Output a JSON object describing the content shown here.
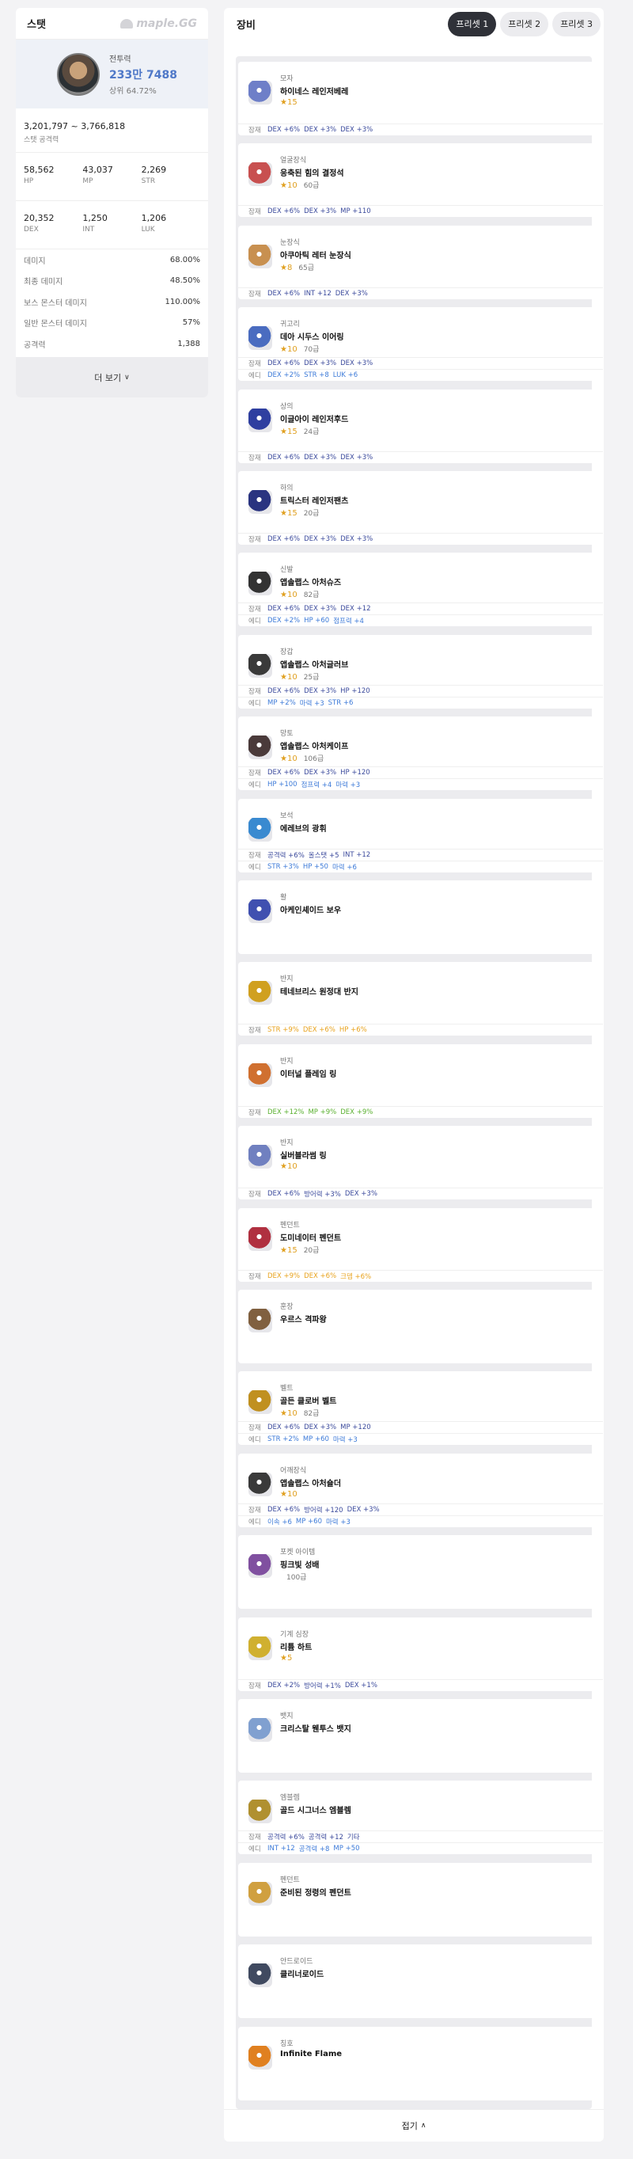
{
  "stat": {
    "title": "스탯",
    "logo": "maple.GG",
    "job": "전투력",
    "power": "233만 7488",
    "rank": "상위 64.72%",
    "range": "3,201,797 ~ 3,766,818",
    "range_label": "스탯 공격력",
    "grid1": [
      {
        "v": "58,562",
        "l": "HP"
      },
      {
        "v": "43,037",
        "l": "MP"
      },
      {
        "v": "2,269",
        "l": "STR"
      }
    ],
    "grid2": [
      {
        "v": "20,352",
        "l": "DEX"
      },
      {
        "v": "1,250",
        "l": "INT"
      },
      {
        "v": "1,206",
        "l": "LUK"
      }
    ],
    "rows": [
      {
        "l": "데미지",
        "v": "68.00%"
      },
      {
        "l": "최종 데미지",
        "v": "48.50%"
      },
      {
        "l": "보스 몬스터 데미지",
        "v": "110.00%"
      },
      {
        "l": "일반 몬스터 데미지",
        "v": "57%"
      },
      {
        "l": "공격력",
        "v": "1,388"
      }
    ],
    "more": "더 보기"
  },
  "equip": {
    "title": "장비",
    "presets": [
      "프리셋 1",
      "프리셋 2",
      "프리셋 3"
    ],
    "fold": "접기",
    "items": [
      {
        "cat": "모자",
        "name": "하이네스 레인저베레",
        "stars": "★15",
        "lv": "",
        "color": "#6e7fc8",
        "lines": [
          {
            "tag": "잠재",
            "opts": [
              {
                "t": "DEX +6%",
                "c": "s1"
              },
              {
                "t": "DEX +3%",
                "c": "s1"
              },
              {
                "t": "DEX +3%",
                "c": "s1"
              }
            ]
          }
        ]
      },
      {
        "cat": "얼굴장식",
        "name": "응축된 힘의 결정석",
        "stars": "★10",
        "lv": "60급",
        "color": "#c85050",
        "lines": [
          {
            "tag": "잠재",
            "opts": [
              {
                "t": "DEX +6%",
                "c": "s1"
              },
              {
                "t": "DEX +3%",
                "c": "s1"
              },
              {
                "t": "MP +110",
                "c": "s1"
              }
            ]
          }
        ]
      },
      {
        "cat": "눈장식",
        "name": "아쿠아틱 레터 눈장식",
        "stars": "★8",
        "lv": "65급",
        "color": "#c89050",
        "lines": [
          {
            "tag": "잠재",
            "opts": [
              {
                "t": "DEX +6%",
                "c": "s1"
              },
              {
                "t": "INT +12",
                "c": "s1"
              },
              {
                "t": "DEX +3%",
                "c": "s1"
              }
            ]
          }
        ]
      },
      {
        "cat": "귀고리",
        "name": "데아 시두스 이어링",
        "stars": "★10",
        "lv": "70급",
        "color": "#4a6cc0",
        "lines": [
          {
            "tag": "잠재",
            "opts": [
              {
                "t": "DEX +6%",
                "c": "s1"
              },
              {
                "t": "DEX +3%",
                "c": "s1"
              },
              {
                "t": "DEX +3%",
                "c": "s1"
              }
            ]
          },
          {
            "tag": "에디",
            "opts": [
              {
                "t": "DEX +2%",
                "c": "s2"
              },
              {
                "t": "STR +8",
                "c": "s2"
              },
              {
                "t": "LUK +6",
                "c": "s2"
              }
            ]
          }
        ]
      },
      {
        "cat": "상의",
        "name": "이글아이 레인저후드",
        "stars": "★15",
        "lv": "24급",
        "color": "#2f3fa0",
        "lines": [
          {
            "tag": "잠재",
            "opts": [
              {
                "t": "DEX +6%",
                "c": "s1"
              },
              {
                "t": "DEX +3%",
                "c": "s1"
              },
              {
                "t": "DEX +3%",
                "c": "s1"
              }
            ]
          }
        ]
      },
      {
        "cat": "하의",
        "name": "트릭스터 레인저팬츠",
        "stars": "★15",
        "lv": "20급",
        "color": "#2a3480",
        "lines": [
          {
            "tag": "잠재",
            "opts": [
              {
                "t": "DEX +6%",
                "c": "s1"
              },
              {
                "t": "DEX +3%",
                "c": "s1"
              },
              {
                "t": "DEX +3%",
                "c": "s1"
              }
            ]
          }
        ]
      },
      {
        "cat": "신발",
        "name": "앱솔랩스 아처슈즈",
        "stars": "★10",
        "lv": "82급",
        "color": "#333333",
        "lines": [
          {
            "tag": "잠재",
            "opts": [
              {
                "t": "DEX +6%",
                "c": "s1"
              },
              {
                "t": "DEX +3%",
                "c": "s1"
              },
              {
                "t": "DEX +12",
                "c": "s1"
              }
            ]
          },
          {
            "tag": "에디",
            "opts": [
              {
                "t": "DEX +2%",
                "c": "s2"
              },
              {
                "t": "HP +60",
                "c": "s2"
              },
              {
                "t": "점프력 +4",
                "c": "s2"
              }
            ]
          }
        ]
      },
      {
        "cat": "장갑",
        "name": "앱솔랩스 아처글러브",
        "stars": "★10",
        "lv": "25급",
        "color": "#3a3a3a",
        "lines": [
          {
            "tag": "잠재",
            "opts": [
              {
                "t": "DEX +6%",
                "c": "s1"
              },
              {
                "t": "DEX +3%",
                "c": "s1"
              },
              {
                "t": "HP +120",
                "c": "s1"
              }
            ]
          },
          {
            "tag": "에디",
            "opts": [
              {
                "t": "MP +2%",
                "c": "s2"
              },
              {
                "t": "마력 +3",
                "c": "s2"
              },
              {
                "t": "STR +6",
                "c": "s2"
              }
            ]
          }
        ]
      },
      {
        "cat": "망토",
        "name": "앱솔랩스 아처케이프",
        "stars": "★10",
        "lv": "106급",
        "color": "#4a3a3a",
        "lines": [
          {
            "tag": "잠재",
            "opts": [
              {
                "t": "DEX +6%",
                "c": "s1"
              },
              {
                "t": "DEX +3%",
                "c": "s1"
              },
              {
                "t": "HP +120",
                "c": "s1"
              }
            ]
          },
          {
            "tag": "에디",
            "opts": [
              {
                "t": "HP +100",
                "c": "s2"
              },
              {
                "t": "점프력 +4",
                "c": "s2"
              },
              {
                "t": "마력 +3",
                "c": "s2"
              }
            ]
          }
        ]
      },
      {
        "cat": "보석",
        "name": "에레브의 광휘",
        "stars": "",
        "lv": "",
        "color": "#3a8ad0",
        "lines": [
          {
            "tag": "잠재",
            "opts": [
              {
                "t": "공격력 +6%",
                "c": "s1"
              },
              {
                "t": "올스탯 +5",
                "c": "s1"
              },
              {
                "t": "INT +12",
                "c": "s1"
              }
            ]
          },
          {
            "tag": "에디",
            "opts": [
              {
                "t": "STR +3%",
                "c": "s2"
              },
              {
                "t": "HP +50",
                "c": "s2"
              },
              {
                "t": "마력 +6",
                "c": "s2"
              }
            ]
          }
        ]
      },
      {
        "cat": "활",
        "name": "아케인셰이드 보우",
        "stars": "",
        "lv": "",
        "color": "#4050b0",
        "lines": []
      },
      {
        "cat": "반지",
        "name": "테네브리스 원정대 반지",
        "stars": "",
        "lv": "",
        "color": "#d0a020",
        "lines": [
          {
            "tag": "잠재",
            "opts": [
              {
                "t": "STR +9%",
                "c": "s3"
              },
              {
                "t": "DEX +6%",
                "c": "s3"
              },
              {
                "t": "HP +6%",
                "c": "s3"
              }
            ]
          }
        ]
      },
      {
        "cat": "반지",
        "name": "이터널 플레임 링",
        "stars": "",
        "lv": "",
        "color": "#d07030",
        "lines": [
          {
            "tag": "잠재",
            "opts": [
              {
                "t": "DEX +12%",
                "c": "s4"
              },
              {
                "t": "MP +9%",
                "c": "s4"
              },
              {
                "t": "DEX +9%",
                "c": "s4"
              }
            ]
          }
        ]
      },
      {
        "cat": "반지",
        "name": "실버블라썸 링",
        "stars": "★10",
        "lv": "",
        "color": "#7080c0",
        "lines": [
          {
            "tag": "잠재",
            "opts": [
              {
                "t": "DEX +6%",
                "c": "s1"
              },
              {
                "t": "방어력 +3%",
                "c": "s1"
              },
              {
                "t": "DEX +3%",
                "c": "s1"
              }
            ]
          }
        ]
      },
      {
        "cat": "펜던트",
        "name": "도미네이터 펜던트",
        "stars": "★15",
        "lv": "20급",
        "color": "#b03040",
        "lines": [
          {
            "tag": "잠재",
            "opts": [
              {
                "t": "DEX +9%",
                "c": "s3"
              },
              {
                "t": "DEX +6%",
                "c": "s3"
              },
              {
                "t": "크뎀 +6%",
                "c": "s3"
              }
            ]
          }
        ]
      },
      {
        "cat": "훈장",
        "name": "우르스 격파왕",
        "stars": "",
        "lv": "",
        "color": "#806040",
        "lines": []
      },
      {
        "cat": "벨트",
        "name": "골든 클로버 벨트",
        "stars": "★10",
        "lv": "82급",
        "color": "#c09020",
        "lines": [
          {
            "tag": "잠재",
            "opts": [
              {
                "t": "DEX +6%",
                "c": "s1"
              },
              {
                "t": "DEX +3%",
                "c": "s1"
              },
              {
                "t": "MP +120",
                "c": "s1"
              }
            ]
          },
          {
            "tag": "에디",
            "opts": [
              {
                "t": "STR +2%",
                "c": "s2"
              },
              {
                "t": "MP +60",
                "c": "s2"
              },
              {
                "t": "마력 +3",
                "c": "s2"
              }
            ]
          }
        ]
      },
      {
        "cat": "어깨장식",
        "name": "앱솔랩스 아처숄더",
        "stars": "★10",
        "lv": "",
        "color": "#3a3a3a",
        "lines": [
          {
            "tag": "잠재",
            "opts": [
              {
                "t": "DEX +6%",
                "c": "s1"
              },
              {
                "t": "방어력 +120",
                "c": "s1"
              },
              {
                "t": "DEX +3%",
                "c": "s1"
              }
            ]
          },
          {
            "tag": "에디",
            "opts": [
              {
                "t": "이속 +6",
                "c": "s2"
              },
              {
                "t": "MP +60",
                "c": "s2"
              },
              {
                "t": "마력 +3",
                "c": "s2"
              }
            ]
          }
        ]
      },
      {
        "cat": "포켓 아이템",
        "name": "핑크빛 성배",
        "stars": "",
        "lv": "100급",
        "color": "#8050a0",
        "lines": []
      },
      {
        "cat": "기계 심장",
        "name": "리튬 하트",
        "stars": "★5",
        "lv": "",
        "color": "#d0b030",
        "lines": [
          {
            "tag": "잠재",
            "opts": [
              {
                "t": "DEX +2%",
                "c": "s1"
              },
              {
                "t": "방어력 +1%",
                "c": "s1"
              },
              {
                "t": "DEX +1%",
                "c": "s1"
              }
            ]
          }
        ]
      },
      {
        "cat": "뱃지",
        "name": "크리스탈 웬투스 뱃지",
        "stars": "",
        "lv": "",
        "color": "#80a0d0",
        "lines": []
      },
      {
        "cat": "엠블렘",
        "name": "골드 시그너스 엠블렘",
        "stars": "",
        "lv": "",
        "color": "#b09030",
        "lines": [
          {
            "tag": "잠재",
            "opts": [
              {
                "t": "공격력 +6%",
                "c": "s1"
              },
              {
                "t": "공격력 +12",
                "c": "s1"
              },
              {
                "t": "기타",
                "c": "s1"
              }
            ]
          },
          {
            "tag": "에디",
            "opts": [
              {
                "t": "INT +12",
                "c": "s2"
              },
              {
                "t": "공격력 +8",
                "c": "s2"
              },
              {
                "t": "MP +50",
                "c": "s2"
              }
            ]
          }
        ]
      },
      {
        "cat": "펜던트",
        "name": "준비된 정령의 펜던트",
        "stars": "",
        "lv": "",
        "color": "#d0a040",
        "lines": []
      },
      {
        "cat": "안드로이드",
        "name": "클리너로이드",
        "stars": "",
        "lv": "",
        "color": "#404a60",
        "lines": []
      },
      {
        "cat": "칭호",
        "name": "Infinite Flame",
        "stars": "",
        "lv": "",
        "color": "#e08020",
        "lines": []
      }
    ]
  }
}
